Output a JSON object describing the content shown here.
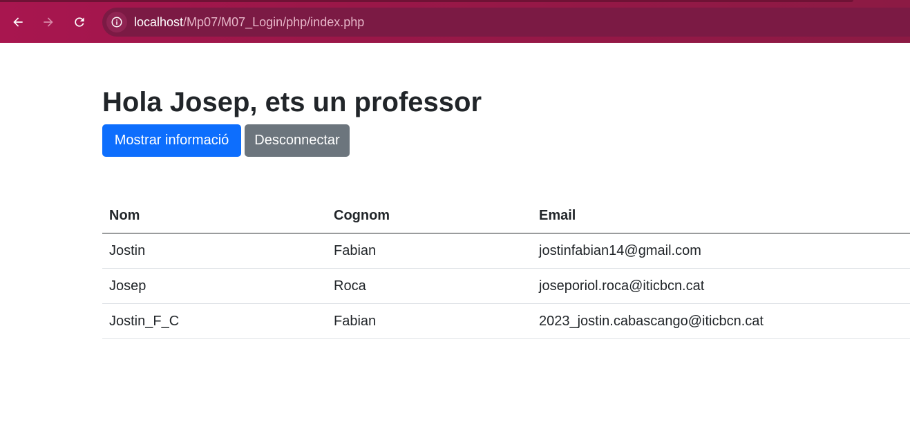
{
  "browser": {
    "url_host": "localhost",
    "url_path": "/Mp07/M07_Login/php/index.php",
    "icons": {
      "back": "back-arrow-icon",
      "forward": "forward-arrow-icon",
      "reload": "reload-icon",
      "site_info": "info-icon"
    },
    "colors": {
      "bar": "#9a1748",
      "address": "#7b1a44"
    }
  },
  "page": {
    "greeting": "Hola Josep, ets un professor",
    "show_info_button": "Mostrar informació",
    "logout_button": "Desconnectar",
    "colors": {
      "primary": "#0d6efd",
      "secondary": "#6c757d"
    }
  },
  "table": {
    "headers": [
      "Nom",
      "Cognom",
      "Email"
    ],
    "rows": [
      {
        "nom": "Jostin",
        "cognom": "Fabian",
        "email": "jostinfabian14@gmail.com"
      },
      {
        "nom": "Josep",
        "cognom": "Roca",
        "email": "joseporiol.roca@iticbcn.cat"
      },
      {
        "nom": "Jostin_F_C",
        "cognom": "Fabian",
        "email": "2023_jostin.cabascango@iticbcn.cat"
      }
    ]
  }
}
